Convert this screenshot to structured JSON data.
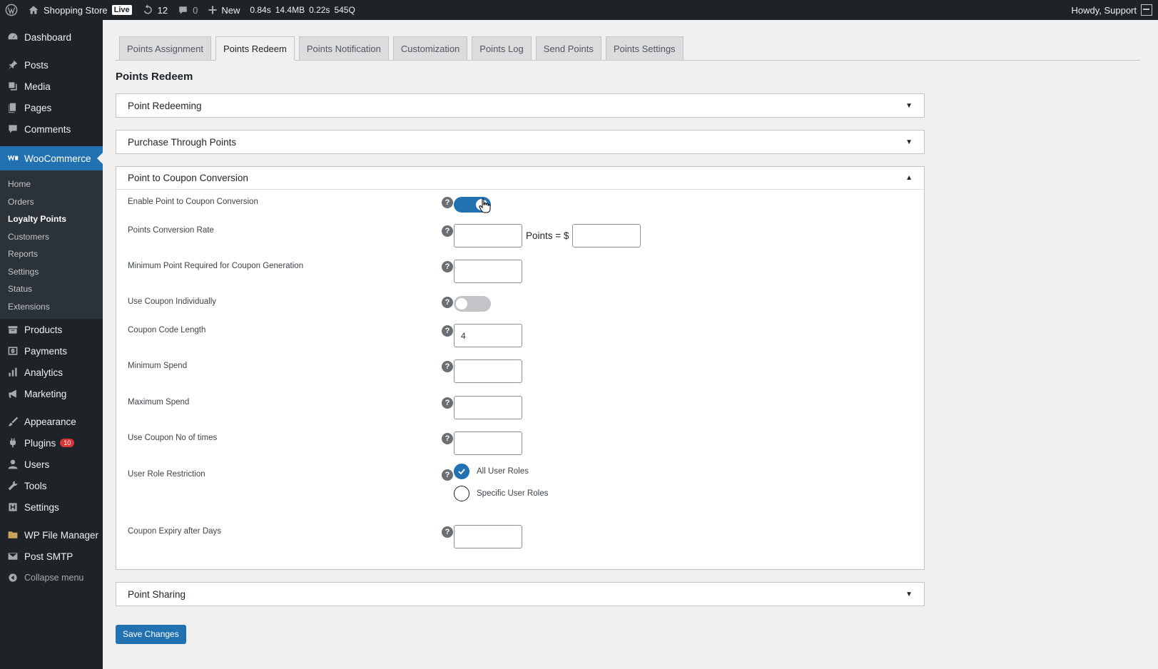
{
  "admin_bar": {
    "site_name": "Shopping Store",
    "live_badge": "Live",
    "updates_count": "12",
    "comments_count": "0",
    "new_label": "New",
    "metrics": [
      "0.84s",
      "14.4MB",
      "0.22s",
      "545Q"
    ],
    "howdy": "Howdy, Support"
  },
  "sidebar": {
    "items_top": [
      {
        "label": "Dashboard",
        "icon": "dashboard-icon"
      }
    ],
    "items_mid": [
      {
        "label": "Posts",
        "icon": "pin-icon"
      },
      {
        "label": "Media",
        "icon": "media-icon"
      },
      {
        "label": "Pages",
        "icon": "pages-icon"
      },
      {
        "label": "Comments",
        "icon": "comment-icon"
      }
    ],
    "woocommerce": "WooCommerce",
    "submenu": [
      "Home",
      "Orders",
      "Loyalty Points",
      "Customers",
      "Reports",
      "Settings",
      "Status",
      "Extensions"
    ],
    "items_store": [
      "Products",
      "Payments",
      "Analytics",
      "Marketing"
    ],
    "items_bottom": [
      "Appearance",
      "Plugins",
      "Users",
      "Tools",
      "Settings"
    ],
    "plugins_badge": "10",
    "items_extra": [
      "WP File Manager",
      "Post SMTP"
    ],
    "collapse": "Collapse menu"
  },
  "tabs": [
    "Points Assignment",
    "Points Redeem",
    "Points Notification",
    "Customization",
    "Points Log",
    "Send Points",
    "Points Settings"
  ],
  "active_tab": "Points Redeem",
  "page_heading": "Points Redeem",
  "panels": {
    "point_redeeming": "Point Redeeming",
    "purchase_through_points": "Purchase Through Points",
    "coupon_conversion": "Point to Coupon Conversion",
    "point_sharing": "Point Sharing"
  },
  "fields": {
    "enable_conversion": {
      "label": "Enable Point to Coupon Conversion",
      "on": true
    },
    "conversion_rate": {
      "label": "Points Conversion Rate",
      "middle_text": "Points = $",
      "points_value": "",
      "dollar_value": ""
    },
    "min_points": {
      "label": "Minimum Point Required for Coupon Generation",
      "value": ""
    },
    "use_individually": {
      "label": "Use Coupon Individually",
      "on": false
    },
    "code_length": {
      "label": "Coupon Code Length",
      "value": "4"
    },
    "min_spend": {
      "label": "Minimum Spend",
      "value": ""
    },
    "max_spend": {
      "label": "Maximum Spend",
      "value": ""
    },
    "use_times": {
      "label": "Use Coupon No of times",
      "value": ""
    },
    "role_restriction": {
      "label": "User Role Restriction",
      "options": [
        "All User Roles",
        "Specific User Roles"
      ],
      "selected": "All User Roles"
    },
    "expiry_days": {
      "label": "Coupon Expiry after Days",
      "value": ""
    }
  },
  "help_glyph": "?",
  "save_button": "Save Changes",
  "colors": {
    "accent": "#2271b1",
    "admin_dark": "#1d2327",
    "badge_red": "#d63638"
  }
}
